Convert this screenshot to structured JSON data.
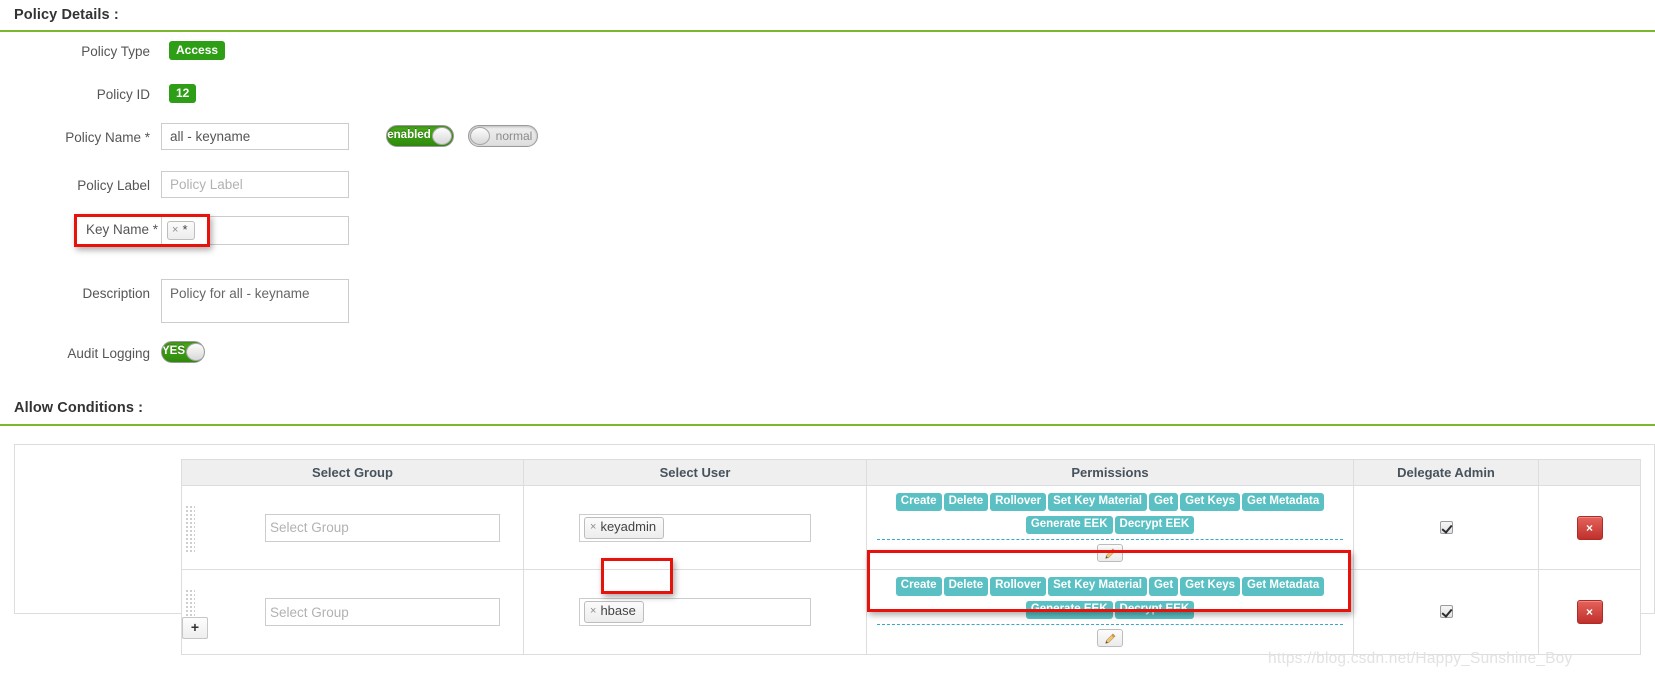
{
  "policy_details": {
    "heading": "Policy Details :",
    "fields": {
      "policy_type_label": "Policy Type",
      "policy_type_value": "Access",
      "policy_id_label": "Policy ID",
      "policy_id_value": "12",
      "policy_name_label": "Policy Name *",
      "policy_name_value": "all - keyname",
      "policy_label_label": "Policy Label",
      "policy_label_placeholder": "Policy Label",
      "policy_label_value": "",
      "key_name_label": "Key Name *",
      "key_name_chip": "*",
      "key_name_chip_remove": "×",
      "description_label": "Description",
      "description_value": "Policy for all - keyname",
      "audit_logging_label": "Audit Logging"
    },
    "toggles": {
      "status": {
        "text": "enabled",
        "state": "on"
      },
      "priority": {
        "text": "normal",
        "state": "off"
      },
      "audit": {
        "text": "YES",
        "state": "on"
      }
    }
  },
  "allow_conditions": {
    "heading": "Allow Conditions :",
    "columns": {
      "group": "Select Group",
      "user": "Select User",
      "permissions": "Permissions",
      "delegate_admin": "Delegate Admin",
      "actions": ""
    },
    "group_placeholder": "Select Group",
    "rows": [
      {
        "group_value": "",
        "user_chips": [
          {
            "label": "keyadmin",
            "remove": "×"
          }
        ],
        "permissions_line1": [
          "Create",
          "Delete",
          "Rollover",
          "Set Key Material",
          "Get",
          "Get Keys",
          "Get Metadata"
        ],
        "permissions_line2": [
          "Generate EEK",
          "Decrypt EEK"
        ],
        "delegate_admin_checked": true,
        "edit_icon": "pencil-icon",
        "delete_label": "×"
      },
      {
        "group_value": "",
        "user_chips": [
          {
            "label": "hbase",
            "remove": "×"
          }
        ],
        "permissions_line1": [
          "Create",
          "Delete",
          "Rollover",
          "Set Key Material",
          "Get",
          "Get Keys",
          "Get Metadata"
        ],
        "permissions_line2": [
          "Generate EEK",
          "Decrypt EEK"
        ],
        "delegate_admin_checked": true,
        "edit_icon": "pencil-icon",
        "delete_label": "×"
      }
    ],
    "add_row_label": "+"
  },
  "watermark": "https://blog.csdn.net/Happy_Sunshine_Boy",
  "colors": {
    "accent_green": "#2e9e16",
    "rule_green": "#7cb82f",
    "permission_teal": "#5bc0c3",
    "delete_red": "#c0302b",
    "highlight_red": "#e8120d"
  }
}
